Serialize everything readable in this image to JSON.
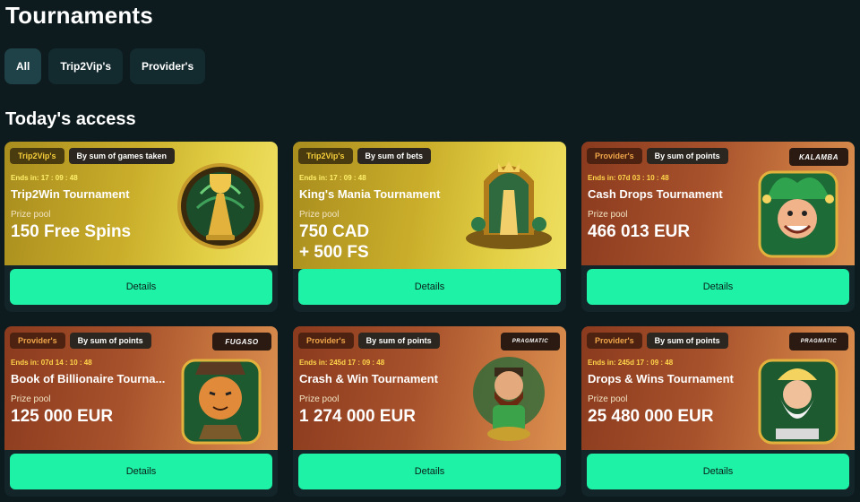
{
  "page_title": "Tournaments",
  "filters": [
    {
      "label": "All",
      "active": true
    },
    {
      "label": "Trip2Vip's",
      "active": false
    },
    {
      "label": "Provider's",
      "active": false
    }
  ],
  "section_title": "Today's access",
  "cards": [
    {
      "type_tag": "Trip2Vip's",
      "mode_tag": "By sum of games taken",
      "ends": "Ends in: 17 : 09 : 48",
      "name": "Trip2Win Tournament",
      "pool_label": "Prize pool",
      "pool_value": "150 Free Spins",
      "details": "Details",
      "theme": "gold",
      "provider": "",
      "art": "trophy-icon"
    },
    {
      "type_tag": "Trip2Vip's",
      "mode_tag": "By sum of bets",
      "ends": "Ends in: 17 : 09 : 48",
      "name": "King's Mania Tournament",
      "pool_label": "Prize pool",
      "pool_value_1": "750 CAD",
      "pool_value_2": "+ 500 FS",
      "details": "Details",
      "theme": "gold",
      "provider": "",
      "art": "throne-icon"
    },
    {
      "type_tag": "Provider's",
      "mode_tag": "By sum of points",
      "ends": "Ends in: 07d 03 : 10 : 48",
      "name": "Cash Drops Tournament",
      "pool_label": "Prize pool",
      "pool_value": "466 013 EUR",
      "details": "Details",
      "theme": "copper",
      "provider": "KALAMBA",
      "art": "jester-icon"
    },
    {
      "type_tag": "Provider's",
      "mode_tag": "By sum of points",
      "ends": "Ends in: 07d 14 : 10 : 48",
      "name": "Book of Billionaire Tourna...",
      "pool_label": "Prize pool",
      "pool_value": "125 000 EUR",
      "details": "Details",
      "theme": "copper",
      "provider": "FUGASO",
      "art": "tiger-icon"
    },
    {
      "type_tag": "Provider's",
      "mode_tag": "By sum of points",
      "ends": "Ends in: 245d 17 : 09 : 48",
      "name": "Crash & Win Tournament",
      "pool_label": "Prize pool",
      "pool_value": "1 274 000 EUR",
      "details": "Details",
      "theme": "copper",
      "provider": "PRAGMATIC",
      "art": "miner-icon"
    },
    {
      "type_tag": "Provider's",
      "mode_tag": "By sum of points",
      "ends": "Ends in: 245d 17 : 09 : 48",
      "name": "Drops & Wins Tournament",
      "pool_label": "Prize pool",
      "pool_value": "25 480 000 EUR",
      "details": "Details",
      "theme": "copper",
      "provider": "PRAGMATIC",
      "art": "zeus-icon"
    }
  ],
  "colors": {
    "background": "#0d1b1e",
    "accent_button": "#1df2a6",
    "gold_banner": "#c9ad2a",
    "copper_banner": "#a8522c"
  }
}
